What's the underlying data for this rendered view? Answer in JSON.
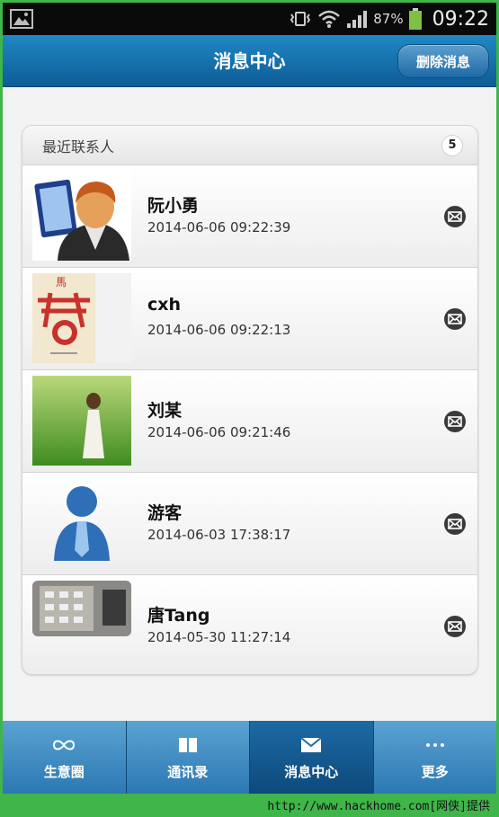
{
  "statusbar": {
    "battery_percent": "87%",
    "time": "09:22"
  },
  "header": {
    "title": "消息中心",
    "delete_label": "删除消息"
  },
  "list": {
    "title": "最近联系人",
    "count": "5",
    "items": [
      {
        "name": "阮小勇",
        "time": "2014-06-06 09:22:39",
        "avatar": "cartoon-man"
      },
      {
        "name": "cxh",
        "time": "2014-06-06 09:22:13",
        "avatar": "red-seal-poster"
      },
      {
        "name": "刘某",
        "time": "2014-06-06 09:21:46",
        "avatar": "girl-on-grass"
      },
      {
        "name": "游客",
        "time": "2014-06-03 17:38:17",
        "avatar": "guest-silhouette"
      },
      {
        "name": "唐Tang",
        "time": "2014-05-30 11:27:14",
        "avatar": "keypad-photo"
      }
    ]
  },
  "tabs": [
    {
      "label": "生意圈",
      "icon": "infinity-icon"
    },
    {
      "label": "通讯录",
      "icon": "book-icon"
    },
    {
      "label": "消息中心",
      "icon": "mail-icon",
      "active": true
    },
    {
      "label": "更多",
      "icon": "more-icon"
    }
  ],
  "watermark": "http://www.hackhome.com[网侠]提供",
  "colors": {
    "header": "#0e5c96",
    "tab_bar": "#2c78b3",
    "active_tab": "#0d4a7c",
    "frame_border": "#3fb54a"
  }
}
